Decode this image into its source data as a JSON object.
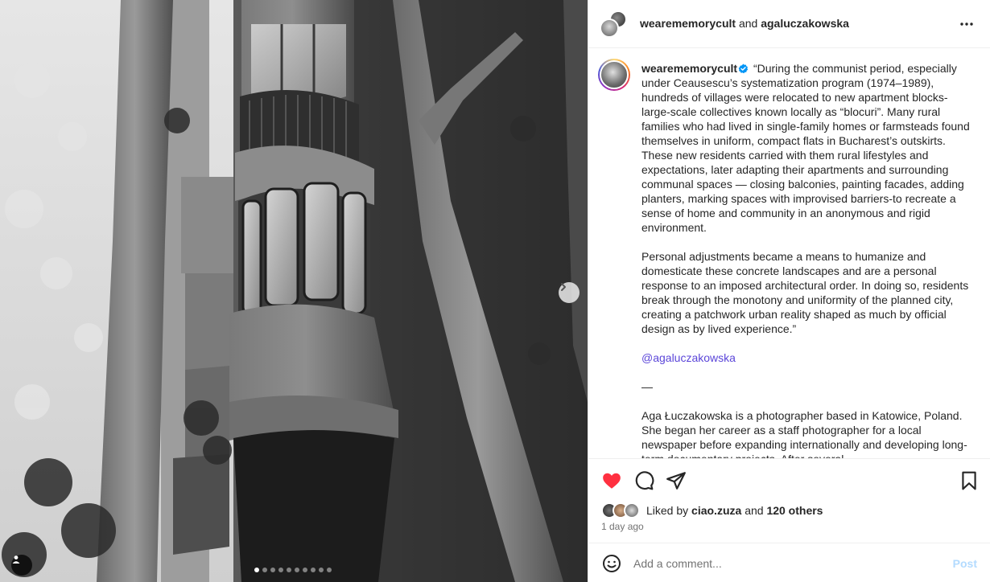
{
  "photo": {
    "alt_icons": {
      "next": "chevron-right-icon",
      "tags": "person-tag-icon"
    },
    "carousel": {
      "total": 10,
      "current": 1
    }
  },
  "header": {
    "account_1": "wearememorycult",
    "joiner": "and",
    "account_2": "agaluczakowska",
    "more_icon": "more-horizontal-icon"
  },
  "caption": {
    "username": "wearememorycult",
    "verified_icon": "verified-badge-icon",
    "paragraph_1": "“During the communist period, especially under Ceausescu’s systematization program (1974–1989), hundreds of villages were relocated to new apartment blocks-large-scale collectives known locally as “blocuri”. Many rural families who had lived in single-family homes or farmsteads found themselves in uniform, compact flats in Bucharest’s outskirts. These new residents carried with them rural lifestyles and expectations, later adapting their apartments and surrounding communal spaces — closing balconies, painting facades, adding planters, marking spaces with improvised barriers-to recreate a sense of home and community in an anonymous and rigid environment.",
    "paragraph_2": "Personal adjustments became a means to humanize and domesticate these concrete landscapes and are a personal response to an imposed architectural order. In doing so, residents break through the monotony and uniformity of the planned city, creating a patchwork urban reality shaped as much by official design as by lived experience.”",
    "mention": "@agaluczakowska",
    "dash": "—",
    "paragraph_3": "Aga Łuczakowska is a photographer based in Katowice, Poland. She began her career as a staff photographer for a local newspaper before expanding internationally and developing long-term documentary projects. After several"
  },
  "actions": {
    "like_icon": "heart-filled-icon",
    "comment_icon": "comment-icon",
    "share_icon": "send-icon",
    "save_icon": "bookmark-icon",
    "liked_prefix": "Liked by",
    "liked_user": "ciao.zuza",
    "liked_and": "and",
    "liked_others": "120 others",
    "timestamp": "1 day ago"
  },
  "comment": {
    "emoji_icon": "emoji-icon",
    "placeholder": "Add a comment...",
    "post_label": "Post"
  },
  "colors": {
    "like_red": "#ff3040",
    "mention": "#5b46d9",
    "post_disabled": "#b3dbff",
    "verified_blue": "#0095f6"
  }
}
